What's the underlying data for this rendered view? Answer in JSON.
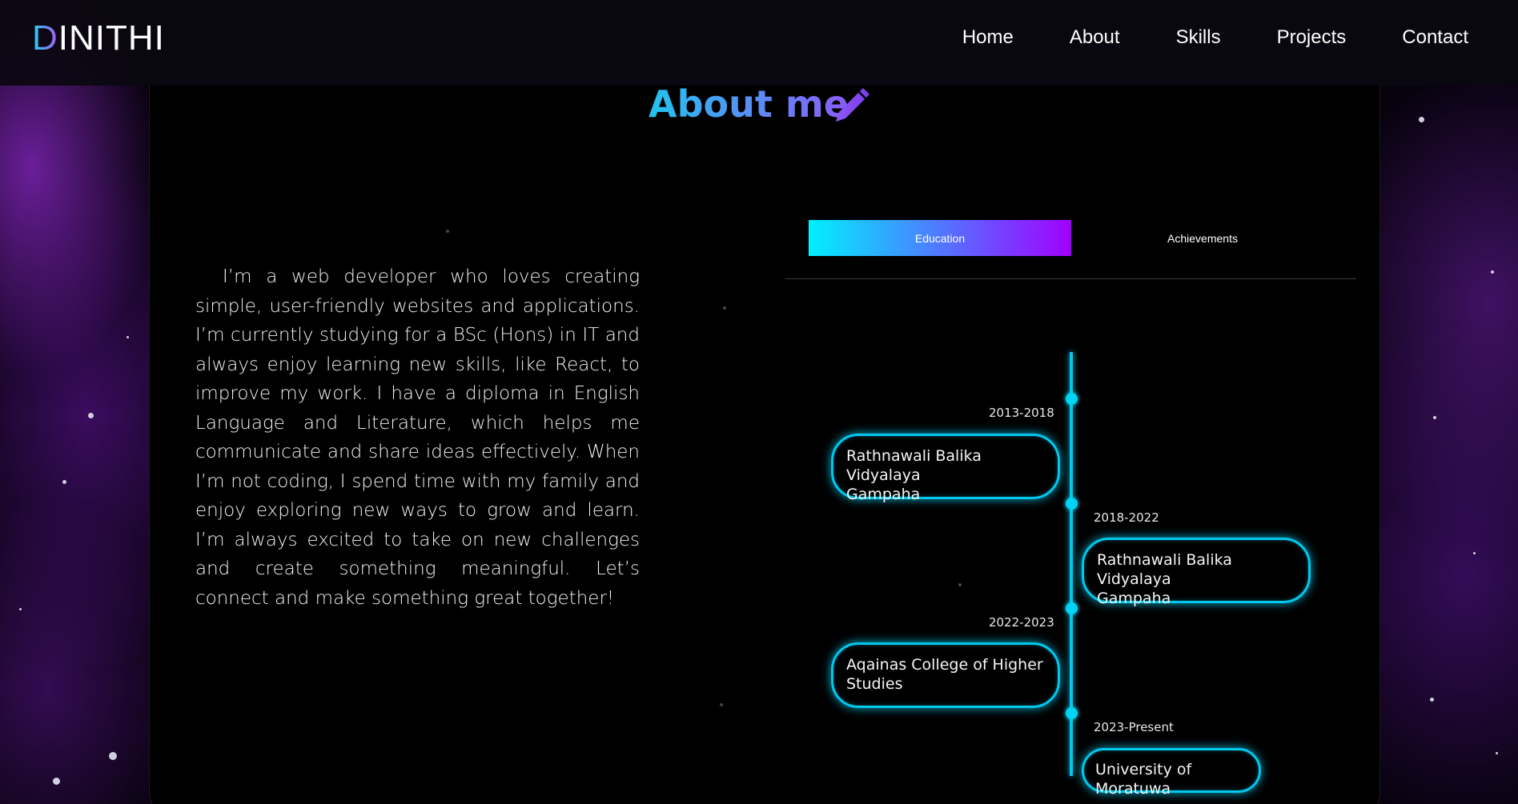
{
  "navbar": {
    "logo_first": "D",
    "logo_rest": "INITHI",
    "links": [
      "Home",
      "About",
      "Skills",
      "Projects",
      "Contact"
    ]
  },
  "about": {
    "title": "About me",
    "title_icon": "pencil-icon",
    "bio": "I’m a web developer who loves creating simple, user-friendly websites and applications. I’m currently studying for a BSc (Hons) in IT and always enjoy learning new skills, like React, to improve my work. I have a diploma in English Language and Literature, which helps me communicate and share ideas effectively. When I’m not coding, I spend time with my family and enjoy exploring new ways to grow and learn. I’m always excited to take on new challenges and create something meaningful. Let’s connect and make something great together!"
  },
  "tabs": {
    "education": "Education",
    "achievements": "Achievements",
    "active": "Education"
  },
  "timeline": [
    {
      "years": "2013-2018",
      "school_line1": "Rathnawali Balika Vidyalaya",
      "school_line2": "Gampaha",
      "side": "left"
    },
    {
      "years": "2018-2022",
      "school_line1": "Rathnawali Balika Vidyalaya",
      "school_line2": "Gampaha",
      "side": "right"
    },
    {
      "years": "2022-2023",
      "school_line1": "Aqainas College of Higher",
      "school_line2": "Studies",
      "side": "left"
    },
    {
      "years": "2023-Present",
      "school_line1": "University of Moratuwa",
      "school_line2": "",
      "side": "right"
    }
  ],
  "colors": {
    "accent_cyan": "#00c8ee",
    "accent_purple": "#a100ff",
    "title_gradient_start": "#22c3f0",
    "title_gradient_end": "#8b5cf6",
    "background": "#000000"
  }
}
